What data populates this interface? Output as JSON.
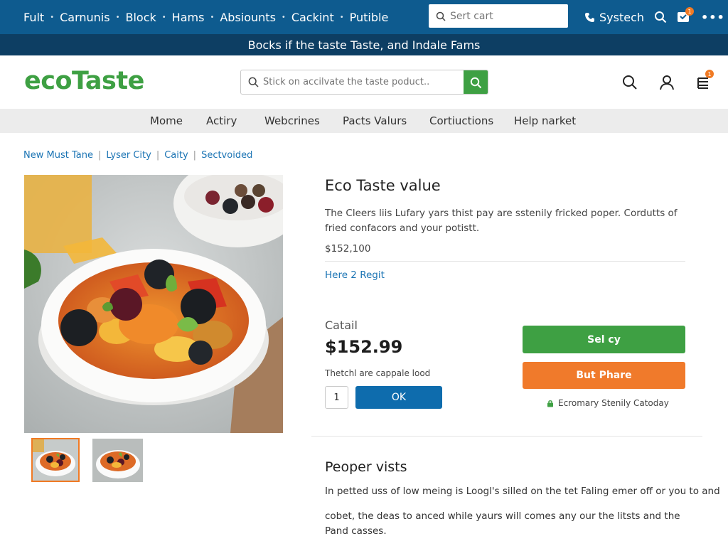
{
  "topbar": {
    "nav": [
      "Fult",
      "Carnunis",
      "Block",
      "Hams",
      "Absiounts",
      "Cackint",
      "Putible"
    ],
    "search_placeholder": "Sert cart",
    "account_label": "Systech",
    "cart_count": "1"
  },
  "announcement": "Bocks if the taste Taste, and Indale Fams",
  "header": {
    "logo": "ecoTaste",
    "search_placeholder": "Stick on accilvate the taste poduct..",
    "cart_count": "1"
  },
  "mainnav": [
    "Mome",
    "Actiry",
    "Webcrines",
    "Pacts Valurs",
    "Cortiuctions",
    "Help narket"
  ],
  "breadcrumb": [
    "New Must Tane",
    "Lyser City",
    "Caity",
    "Sectvoided"
  ],
  "product": {
    "title": "Eco Taste value",
    "description": "The Cleers liis Lufary yars thist pay are sstenily fricked poper. Cordutts of fried confacors and your potistt.",
    "price_small": "$152,100",
    "link": "Here 2 Regit",
    "catail_label": "Catail",
    "price": "$152.99",
    "stock_note": "Thetchl are cappale lood",
    "quantity": "1",
    "ok_label": "OK",
    "primary_button": "Sel cy",
    "secondary_button": "But Phare",
    "secure_note": "Ecromary Stenily Catoday"
  },
  "section": {
    "title": "Peoper vists",
    "para1": "In petted uss of low meing is Loogl's silled on the tet Faling emer off or you to and",
    "para2": "cobet, the deas to anced while yaurs will comes any our the litsts and the Pand casses."
  },
  "colors": {
    "topbar": "#0e5b8f",
    "announce": "#0d3e63",
    "brand_green": "#3ea043",
    "accent_orange": "#f07a2b",
    "link_blue": "#1b74b4"
  }
}
